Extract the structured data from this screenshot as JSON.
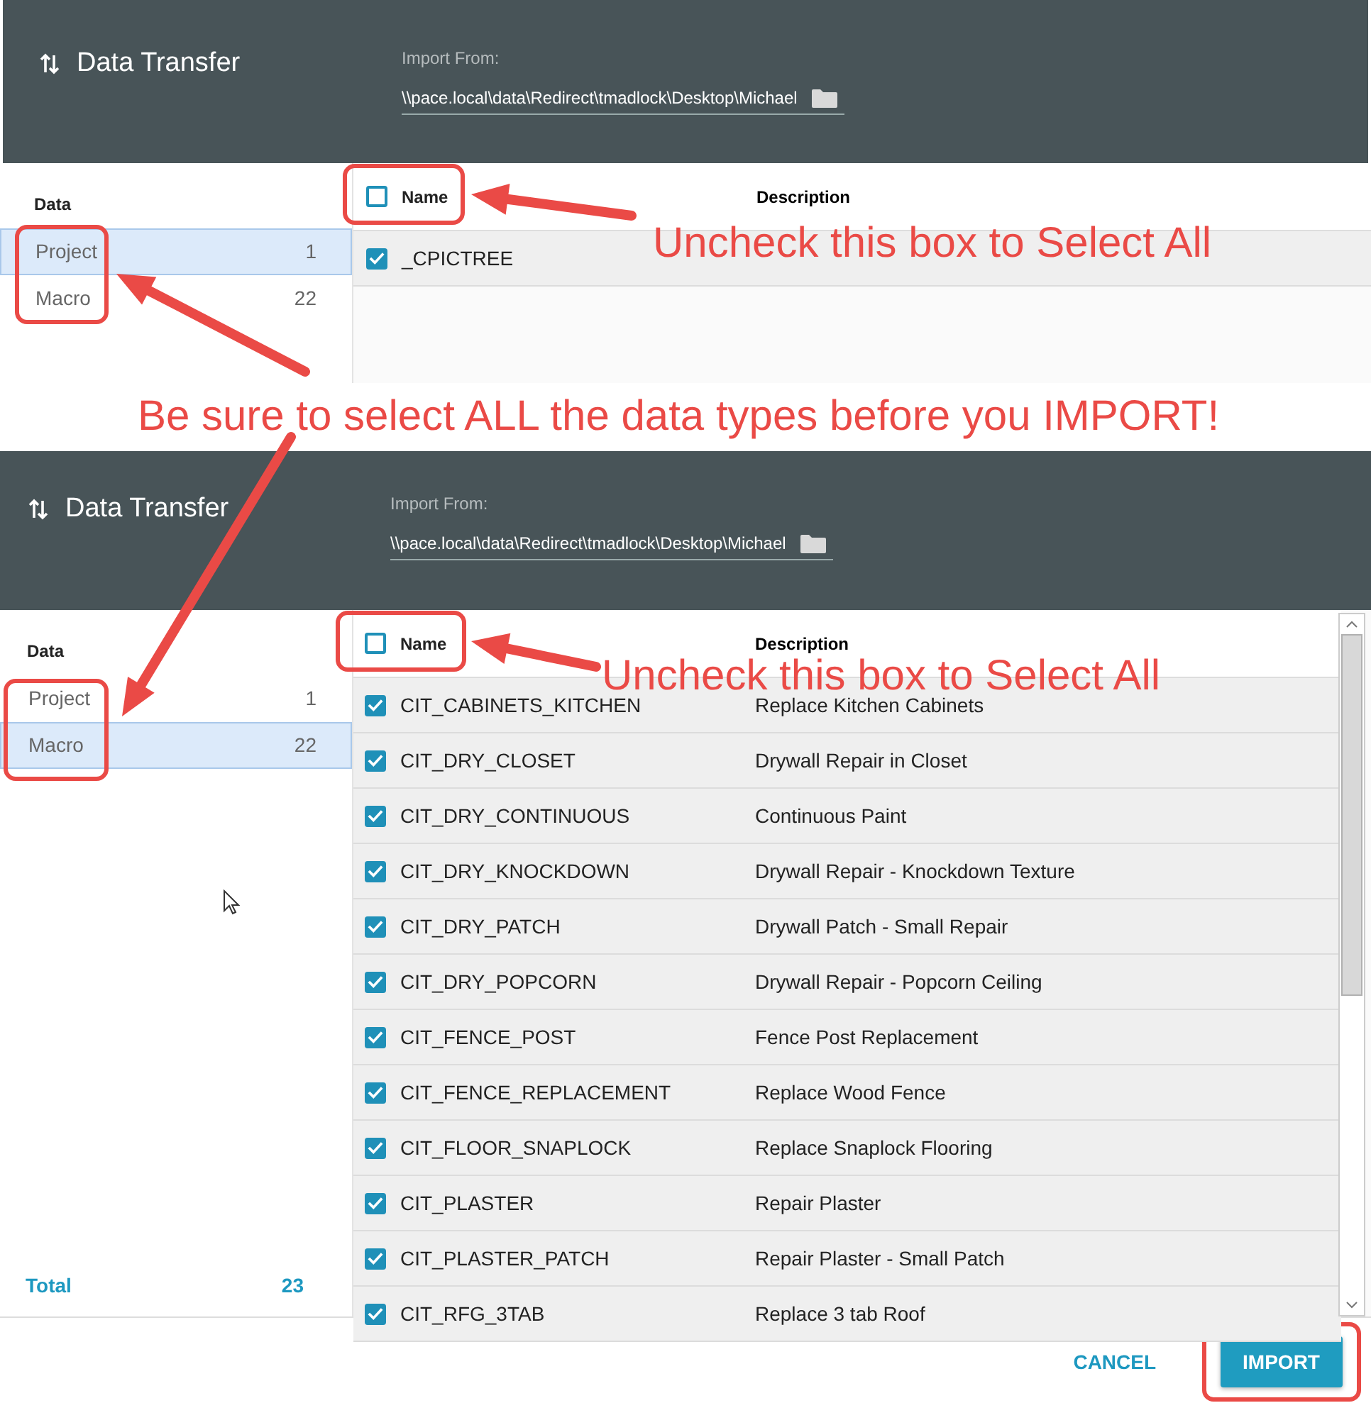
{
  "screens": [
    {
      "title": "Data Transfer",
      "import_label": "Import From:",
      "path": "\\\\pace.local\\data\\Redirect\\tmadlock\\Desktop\\Michael",
      "data_heading": "Data",
      "data_types": [
        {
          "name": "Project",
          "count": "1",
          "selected": true
        },
        {
          "name": "Macro",
          "count": "22",
          "selected": false
        }
      ],
      "columns": [
        "Name",
        "Description"
      ],
      "select_all": false,
      "rows": [
        {
          "name": "_CPICTREE",
          "checked": true
        }
      ],
      "callout": "Uncheck this box to Select All"
    },
    {
      "title": "Data Transfer",
      "import_label": "Import From:",
      "path": "\\\\pace.local\\data\\Redirect\\tmadlock\\Desktop\\Michael",
      "data_heading": "Data",
      "data_types": [
        {
          "name": "Project",
          "count": "1",
          "selected": false
        },
        {
          "name": "Macro",
          "count": "22",
          "selected": true
        }
      ],
      "columns": [
        "Name",
        "Description"
      ],
      "select_all": false,
      "rows": [
        {
          "name": "CIT_CABINETS_KITCHEN",
          "description": "Replace Kitchen Cabinets",
          "checked": true
        },
        {
          "name": "CIT_DRY_CLOSET",
          "description": "Drywall Repair in Closet",
          "checked": true
        },
        {
          "name": "CIT_DRY_CONTINUOUS",
          "description": "Continuous Paint",
          "checked": true
        },
        {
          "name": "CIT_DRY_KNOCKDOWN",
          "description": "Drywall Repair - Knockdown Texture",
          "checked": true
        },
        {
          "name": "CIT_DRY_PATCH",
          "description": "Drywall Patch - Small Repair",
          "checked": true
        },
        {
          "name": "CIT_DRY_POPCORN",
          "description": "Drywall Repair - Popcorn Ceiling",
          "checked": true
        },
        {
          "name": "CIT_FENCE_POST",
          "description": "Fence Post Replacement",
          "checked": true
        },
        {
          "name": "CIT_FENCE_REPLACEMENT",
          "description": "Replace Wood Fence",
          "checked": true
        },
        {
          "name": "CIT_FLOOR_SNAPLOCK",
          "description": "Replace Snaplock Flooring",
          "checked": true
        },
        {
          "name": "CIT_PLASTER",
          "description": "Repair Plaster",
          "checked": true
        },
        {
          "name": "CIT_PLASTER_PATCH",
          "description": "Repair Plaster - Small Patch",
          "checked": true
        },
        {
          "name": "CIT_RFG_3TAB",
          "description": "Replace 3 tab Roof",
          "checked": true
        }
      ],
      "callout": "Uncheck this box to Select All",
      "total_label": "Total",
      "total": "23",
      "buttons": [
        {
          "label": "CANCEL",
          "kind": "text"
        },
        {
          "label": "IMPORT",
          "kind": "primary"
        }
      ]
    }
  ],
  "banner": "Be sure to select ALL the data types before you IMPORT!"
}
